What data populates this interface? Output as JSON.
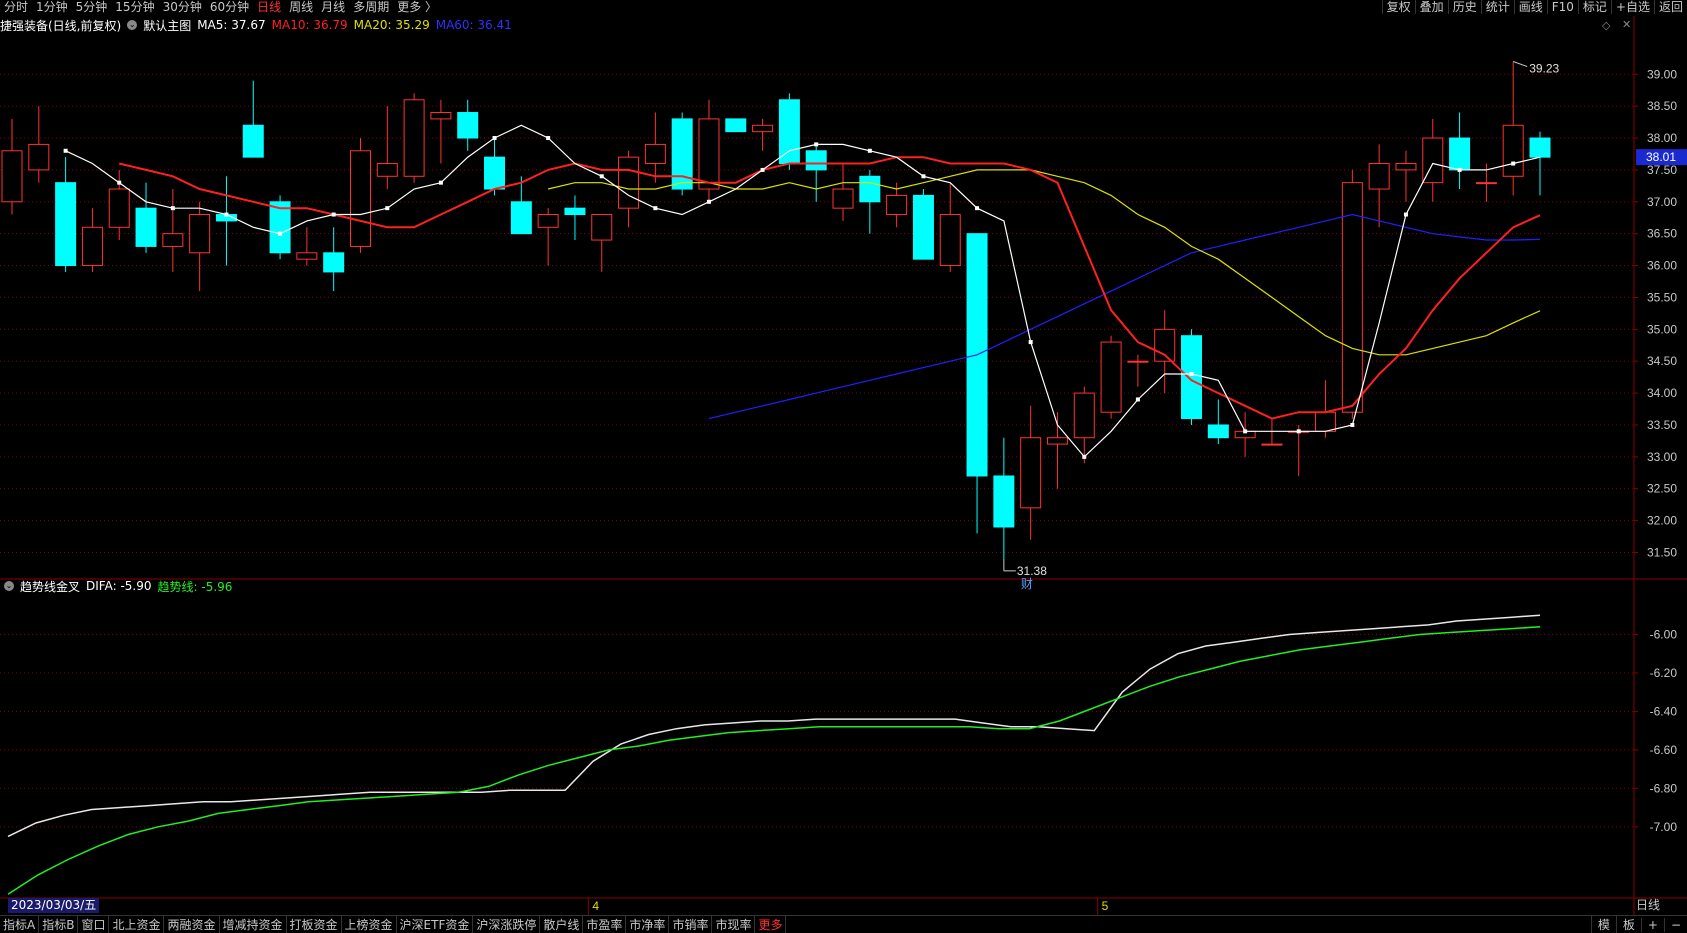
{
  "toolbar": {
    "left_items": [
      "分时",
      "1分钟",
      "5分钟",
      "15分钟",
      "30分钟",
      "60分钟",
      "日线",
      "周线",
      "月线",
      "多周期",
      "更多 〉"
    ],
    "active_item": "日线",
    "right_items": [
      "复权",
      "叠加",
      "历史",
      "统计",
      "画线",
      "F10",
      "标记",
      "+自选",
      "返回"
    ]
  },
  "info": {
    "stock_name": "捷强装备(日线,前复权)",
    "template": "默认主图",
    "ma5_label": "MA5: 37.67",
    "ma10_label": "MA10: 36.79",
    "ma20_label": "MA20: 35.29",
    "ma60_label": "MA60: 36.41"
  },
  "indicator": {
    "name": "趋势线金叉",
    "difa_label": "DIFA: -5.90",
    "trend_label": "趋势线: -5.96"
  },
  "date_label": "2023/03/03/五",
  "period_label": "日线",
  "current_price_label": "38.01",
  "annotations": {
    "high": "39.23",
    "low": "31.38",
    "fin_marker": "财",
    "month_4": "4",
    "month_5": "5"
  },
  "statusbar": {
    "items": [
      "指标A",
      "指标B",
      "窗口",
      "北上资金",
      "两融资金",
      "增减持资金",
      "打板资金",
      "上榜资金",
      "沪深ETF资金",
      "沪深涨跌停",
      "散户线",
      "市盈率",
      "市净率",
      "市销率",
      "市现率",
      "更多"
    ],
    "active_item": "更多",
    "right_items": [
      "模",
      "板",
      "+",
      "−"
    ]
  },
  "colors": {
    "up": "#ff3232",
    "down": "#00ffff",
    "ma5": "#ffffff",
    "ma10": "#ff2020",
    "ma20": "#e0e000",
    "ma60": "#2020ff",
    "difa": "#e8e8e8",
    "trend": "#22ee22",
    "grid": "#8b0000"
  },
  "chart_data": [
    {
      "type": "candlestick",
      "title": "捷强装备(日线,前复权)",
      "y_ticks": [
        39.0,
        38.5,
        38.0,
        37.5,
        37.0,
        36.5,
        36.0,
        35.5,
        35.0,
        34.5,
        34.0,
        33.5,
        33.0,
        32.5,
        32.0,
        31.5
      ],
      "ylim": [
        31.1,
        39.6
      ],
      "candles": [
        {
          "o": 37.0,
          "h": 38.3,
          "l": 36.8,
          "c": 37.8
        },
        {
          "o": 37.5,
          "h": 38.5,
          "l": 37.3,
          "c": 37.9
        },
        {
          "o": 37.3,
          "h": 37.7,
          "l": 35.9,
          "c": 36.0
        },
        {
          "o": 36.0,
          "h": 36.9,
          "l": 35.9,
          "c": 36.6
        },
        {
          "o": 36.6,
          "h": 37.5,
          "l": 36.4,
          "c": 37.2
        },
        {
          "o": 36.9,
          "h": 37.3,
          "l": 36.2,
          "c": 36.3
        },
        {
          "o": 36.3,
          "h": 37.2,
          "l": 35.9,
          "c": 36.5
        },
        {
          "o": 36.2,
          "h": 37.0,
          "l": 35.6,
          "c": 36.8
        },
        {
          "o": 36.8,
          "h": 37.4,
          "l": 36.0,
          "c": 36.7
        },
        {
          "o": 38.2,
          "h": 38.9,
          "l": 37.7,
          "c": 37.7
        },
        {
          "o": 37.0,
          "h": 37.1,
          "l": 36.1,
          "c": 36.2
        },
        {
          "o": 36.1,
          "h": 36.6,
          "l": 36.0,
          "c": 36.2
        },
        {
          "o": 36.2,
          "h": 36.6,
          "l": 35.6,
          "c": 35.9
        },
        {
          "o": 36.3,
          "h": 38.0,
          "l": 36.2,
          "c": 37.8
        },
        {
          "o": 37.4,
          "h": 38.5,
          "l": 37.2,
          "c": 37.6
        },
        {
          "o": 37.4,
          "h": 38.7,
          "l": 37.3,
          "c": 38.6
        },
        {
          "o": 38.3,
          "h": 38.6,
          "l": 37.6,
          "c": 38.4
        },
        {
          "o": 38.4,
          "h": 38.6,
          "l": 37.8,
          "c": 38.0
        },
        {
          "o": 37.7,
          "h": 38.0,
          "l": 37.1,
          "c": 37.2
        },
        {
          "o": 37.0,
          "h": 37.4,
          "l": 36.5,
          "c": 36.5
        },
        {
          "o": 36.6,
          "h": 36.9,
          "l": 36.0,
          "c": 36.8
        },
        {
          "o": 36.9,
          "h": 37.1,
          "l": 36.4,
          "c": 36.8
        },
        {
          "o": 36.4,
          "h": 36.8,
          "l": 35.9,
          "c": 36.8
        },
        {
          "o": 36.9,
          "h": 37.8,
          "l": 36.6,
          "c": 37.7
        },
        {
          "o": 37.6,
          "h": 38.4,
          "l": 37.3,
          "c": 37.9
        },
        {
          "o": 38.3,
          "h": 38.4,
          "l": 37.1,
          "c": 37.2
        },
        {
          "o": 37.2,
          "h": 38.6,
          "l": 37.0,
          "c": 38.3
        },
        {
          "o": 38.3,
          "h": 38.3,
          "l": 38.1,
          "c": 38.1
        },
        {
          "o": 38.1,
          "h": 38.3,
          "l": 37.8,
          "c": 38.2
        },
        {
          "o": 38.6,
          "h": 38.7,
          "l": 37.5,
          "c": 37.6
        },
        {
          "o": 37.8,
          "h": 37.9,
          "l": 37.0,
          "c": 37.5
        },
        {
          "o": 36.9,
          "h": 37.6,
          "l": 36.7,
          "c": 37.2
        },
        {
          "o": 37.4,
          "h": 37.5,
          "l": 36.5,
          "c": 37.0
        },
        {
          "o": 36.8,
          "h": 37.3,
          "l": 36.6,
          "c": 37.1
        },
        {
          "o": 37.1,
          "h": 37.2,
          "l": 36.1,
          "c": 36.1
        },
        {
          "o": 36.0,
          "h": 37.3,
          "l": 35.9,
          "c": 36.8
        },
        {
          "o": 36.5,
          "h": 36.5,
          "l": 31.8,
          "c": 32.7
        },
        {
          "o": 32.7,
          "h": 33.3,
          "l": 31.4,
          "c": 31.9
        },
        {
          "o": 32.2,
          "h": 33.8,
          "l": 31.7,
          "c": 33.3
        },
        {
          "o": 33.2,
          "h": 33.7,
          "l": 32.5,
          "c": 33.3
        },
        {
          "o": 33.3,
          "h": 34.1,
          "l": 32.9,
          "c": 34.0
        },
        {
          "o": 33.7,
          "h": 34.9,
          "l": 33.6,
          "c": 34.8
        },
        {
          "o": 34.5,
          "h": 34.6,
          "l": 34.1,
          "c": 34.5
        },
        {
          "o": 34.5,
          "h": 35.3,
          "l": 34.0,
          "c": 35.0
        },
        {
          "o": 34.9,
          "h": 35.0,
          "l": 33.5,
          "c": 33.6
        },
        {
          "o": 33.5,
          "h": 33.9,
          "l": 33.2,
          "c": 33.3
        },
        {
          "o": 33.3,
          "h": 33.7,
          "l": 33.0,
          "c": 33.4
        },
        {
          "o": 33.2,
          "h": 33.6,
          "l": 33.2,
          "c": 33.2
        },
        {
          "o": 33.4,
          "h": 33.5,
          "l": 32.7,
          "c": 33.4
        },
        {
          "o": 33.4,
          "h": 34.2,
          "l": 33.3,
          "c": 33.7
        },
        {
          "o": 33.7,
          "h": 37.5,
          "l": 33.6,
          "c": 37.3
        },
        {
          "o": 37.2,
          "h": 37.9,
          "l": 36.6,
          "c": 37.6
        },
        {
          "o": 37.5,
          "h": 37.8,
          "l": 37.0,
          "c": 37.6
        },
        {
          "o": 37.3,
          "h": 38.3,
          "l": 37.0,
          "c": 38.0
        },
        {
          "o": 38.0,
          "h": 38.4,
          "l": 37.2,
          "c": 37.5
        },
        {
          "o": 37.3,
          "h": 37.6,
          "l": 37.0,
          "c": 37.3
        },
        {
          "o": 37.4,
          "h": 39.2,
          "l": 37.1,
          "c": 38.2
        },
        {
          "o": 38.0,
          "h": 38.1,
          "l": 37.1,
          "c": 37.7
        }
      ],
      "ma5": [
        37.8,
        37.6,
        37.3,
        37.0,
        36.9,
        36.9,
        36.8,
        36.6,
        36.5,
        36.7,
        36.8,
        36.8,
        36.9,
        37.2,
        37.3,
        37.7,
        38.0,
        38.2,
        38.0,
        37.6,
        37.4,
        37.1,
        36.9,
        36.8,
        37.0,
        37.2,
        37.5,
        37.8,
        37.9,
        37.9,
        37.8,
        37.7,
        37.4,
        37.3,
        36.9,
        36.7,
        34.8,
        33.5,
        33.0,
        33.4,
        33.9,
        34.3,
        34.3,
        34.2,
        33.4,
        33.4,
        33.4,
        33.4,
        33.5,
        35.1,
        36.8,
        37.6,
        37.5,
        37.5,
        37.6,
        37.7
      ],
      "ma10": [
        37.6,
        37.5,
        37.4,
        37.2,
        37.1,
        37.0,
        36.9,
        36.9,
        36.8,
        36.7,
        36.6,
        36.6,
        36.8,
        37.0,
        37.2,
        37.3,
        37.5,
        37.6,
        37.5,
        37.5,
        37.4,
        37.4,
        37.3,
        37.3,
        37.5,
        37.6,
        37.6,
        37.6,
        37.6,
        37.7,
        37.7,
        37.6,
        37.6,
        37.6,
        37.5,
        37.3,
        36.3,
        35.3,
        34.8,
        34.6,
        34.2,
        34.0,
        33.8,
        33.6,
        33.7,
        33.7,
        33.8,
        34.3,
        34.7,
        35.3,
        35.8,
        36.2,
        36.6,
        36.79
      ],
      "ma20": [
        37.2,
        37.3,
        37.3,
        37.2,
        37.2,
        37.3,
        37.3,
        37.2,
        37.2,
        37.3,
        37.2,
        37.3,
        37.3,
        37.2,
        37.3,
        37.4,
        37.5,
        37.5,
        37.5,
        37.4,
        37.3,
        37.1,
        36.8,
        36.6,
        36.3,
        36.1,
        35.8,
        35.5,
        35.2,
        34.9,
        34.7,
        34.6,
        34.6,
        34.7,
        34.8,
        34.9,
        35.1,
        35.29
      ],
      "ma60": [
        33.6,
        33.7,
        33.8,
        33.9,
        34.0,
        34.1,
        34.2,
        34.3,
        34.4,
        34.5,
        34.6,
        34.8,
        35.0,
        35.2,
        35.4,
        35.6,
        35.8,
        36.0,
        36.2,
        36.3,
        36.4,
        36.5,
        36.6,
        36.7,
        36.8,
        36.7,
        36.6,
        36.5,
        36.45,
        36.4,
        36.4,
        36.41
      ],
      "annotations": [
        "39.23",
        "31.38",
        "财"
      ]
    },
    {
      "type": "line",
      "title": "趋势线金叉",
      "y_ticks": [
        -6.0,
        -6.2,
        -6.4,
        -6.6,
        -6.8,
        -7.0
      ],
      "ylim": [
        -7.37,
        -5.8
      ],
      "series": [
        {
          "name": "DIFA",
          "values": [
            -7.05,
            -6.98,
            -6.94,
            -6.91,
            -6.9,
            -6.89,
            -6.88,
            -6.87,
            -6.87,
            -6.86,
            -6.85,
            -6.84,
            -6.83,
            -6.82,
            -6.82,
            -6.82,
            -6.82,
            -6.82,
            -6.81,
            -6.81,
            -6.81,
            -6.66,
            -6.57,
            -6.52,
            -6.49,
            -6.47,
            -6.46,
            -6.45,
            -6.45,
            -6.44,
            -6.44,
            -6.44,
            -6.44,
            -6.44,
            -6.44,
            -6.46,
            -6.48,
            -6.48,
            -6.49,
            -6.5,
            -6.3,
            -6.18,
            -6.1,
            -6.06,
            -6.04,
            -6.02,
            -6.0,
            -5.99,
            -5.98,
            -5.97,
            -5.96,
            -5.95,
            -5.93,
            -5.92,
            -5.91,
            -5.9
          ]
        },
        {
          "name": "趋势线",
          "values": [
            -7.35,
            -7.25,
            -7.17,
            -7.1,
            -7.04,
            -7.0,
            -6.97,
            -6.93,
            -6.91,
            -6.89,
            -6.87,
            -6.86,
            -6.85,
            -6.84,
            -6.83,
            -6.82,
            -6.79,
            -6.73,
            -6.68,
            -6.64,
            -6.6,
            -6.58,
            -6.55,
            -6.53,
            -6.51,
            -6.5,
            -6.49,
            -6.48,
            -6.48,
            -6.48,
            -6.48,
            -6.48,
            -6.48,
            -6.49,
            -6.49,
            -6.45,
            -6.39,
            -6.33,
            -6.27,
            -6.22,
            -6.18,
            -6.14,
            -6.11,
            -6.08,
            -6.06,
            -6.04,
            -6.02,
            -6.0,
            -5.99,
            -5.98,
            -5.97,
            -5.96
          ]
        }
      ],
      "x_labels": [
        "4",
        "5"
      ]
    }
  ]
}
